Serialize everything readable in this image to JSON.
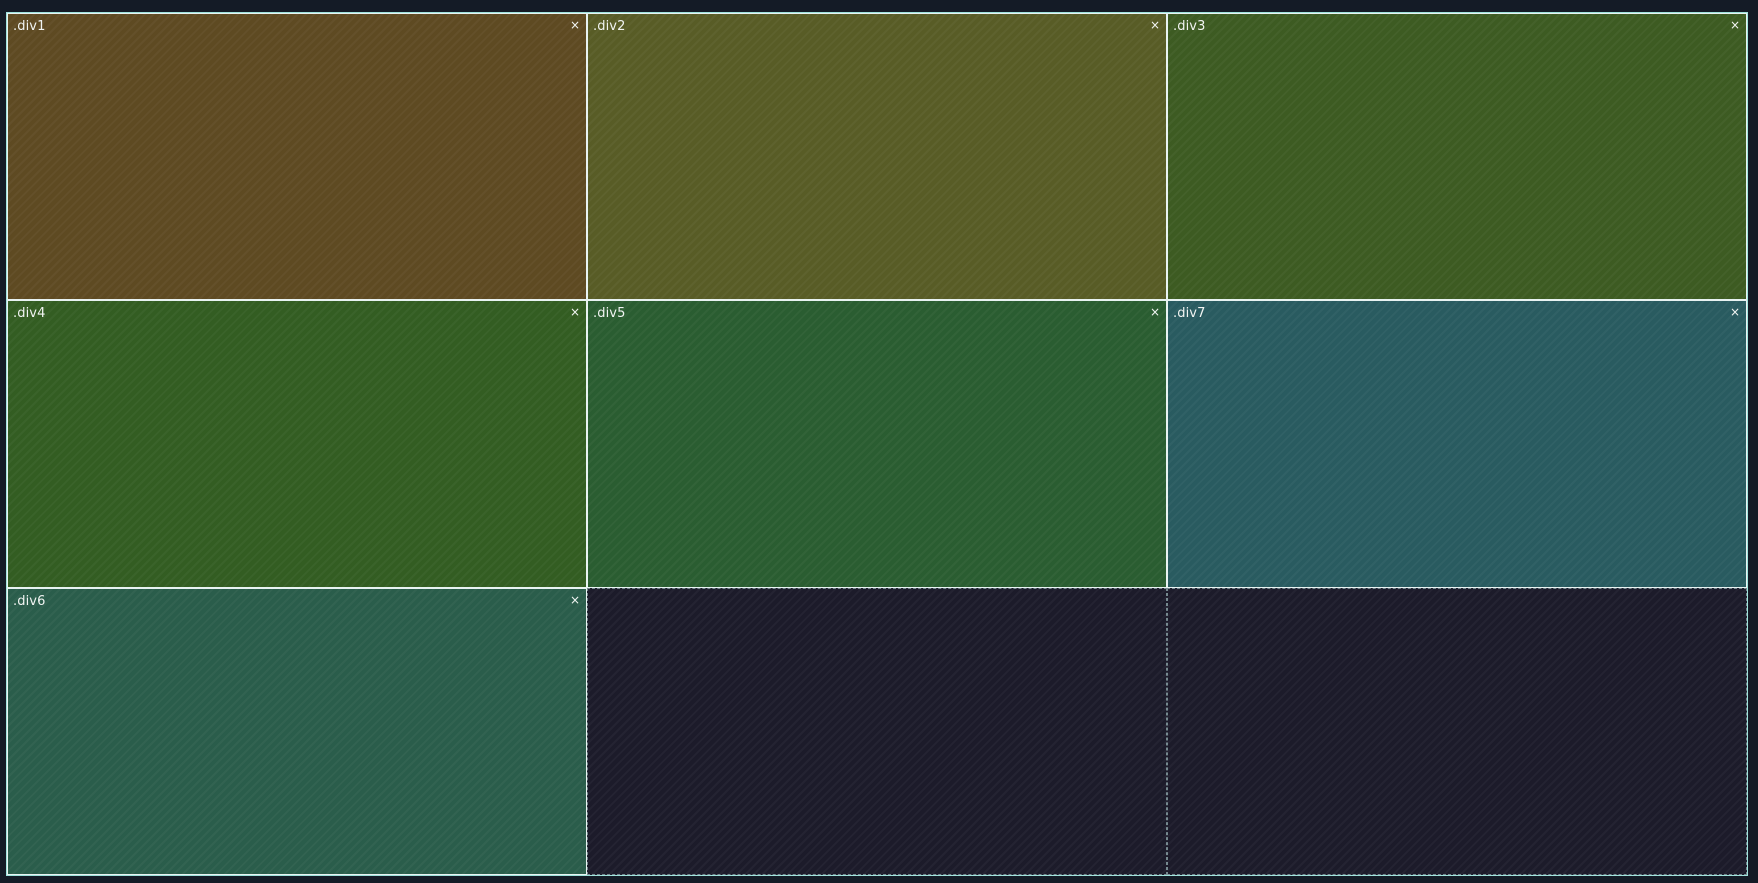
{
  "cells": [
    {
      "label": ".div1",
      "close": "×",
      "color": "#5e4a22"
    },
    {
      "label": ".div2",
      "close": "×",
      "color": "#585c26"
    },
    {
      "label": ".div3",
      "close": "×",
      "color": "#3d5b22"
    },
    {
      "label": ".div4",
      "close": "×",
      "color": "#335d22"
    },
    {
      "label": ".div5",
      "close": "×",
      "color": "#2a5d31"
    },
    {
      "label": ".div7",
      "close": "×",
      "color": "#295b60"
    },
    {
      "label": ".div6",
      "close": "×",
      "color": "#2a5d4b"
    }
  ],
  "colors": {
    "page_background": "#141b26",
    "empty_slot": "#1c1b2a",
    "outline": "#9fe3dc"
  }
}
